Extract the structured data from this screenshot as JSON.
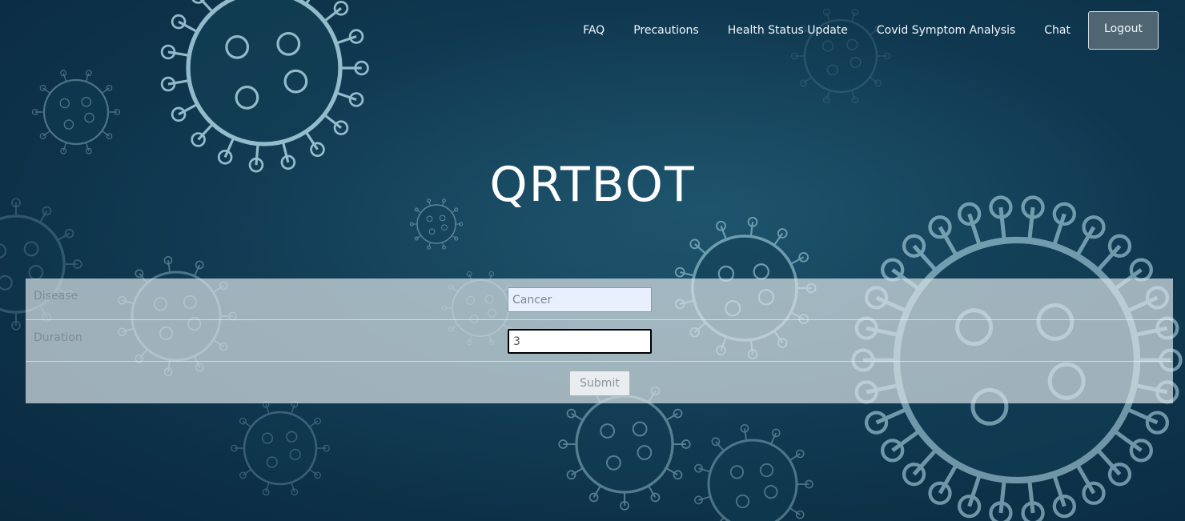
{
  "nav": {
    "items": [
      {
        "label": "FAQ"
      },
      {
        "label": "Precautions"
      },
      {
        "label": "Health Status Update"
      },
      {
        "label": "Covid Symptom Analysis"
      },
      {
        "label": "Chat"
      }
    ],
    "logout_label": "Logout"
  },
  "page": {
    "title": "QRTBOT"
  },
  "form": {
    "disease_label": "Disease",
    "disease_value": "Cancer",
    "duration_label": "Duration",
    "duration_value": "3",
    "submit_label": "Submit"
  },
  "colors": {
    "background": "#0f3850",
    "form_panel": "#d7e1e5",
    "logout_button": "#4f6672"
  },
  "background_image": "virus-particles"
}
